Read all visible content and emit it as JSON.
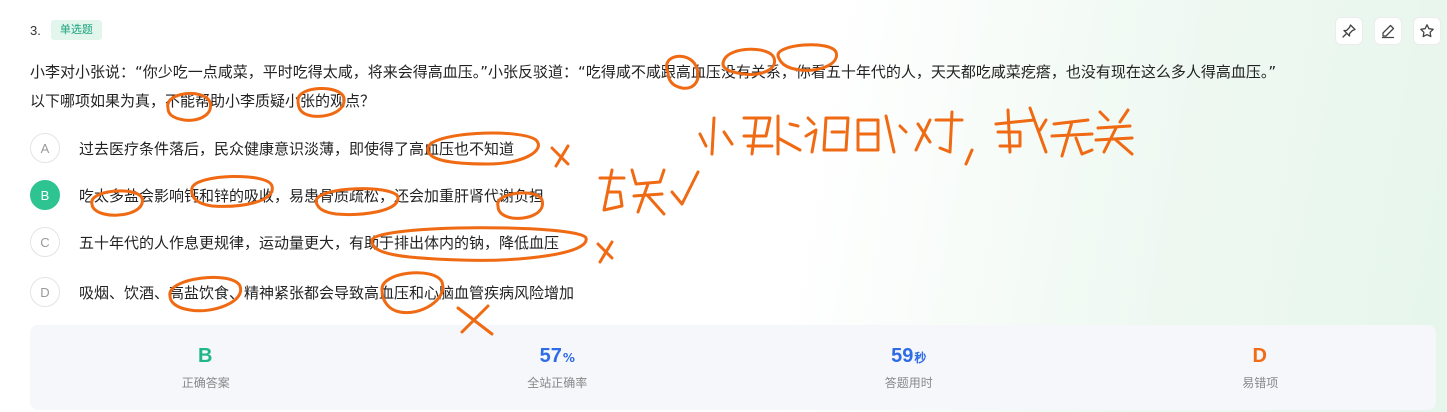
{
  "question": {
    "number": "3.",
    "type_badge": "单选题",
    "stem_line1": "小李对小张说：“你少吃一点咸菜，平时吃得太咸，将来会得高血压。”小张反驳道：“吃得咸不咸跟高血压没有关系，你看五十年代的人，天天都吃咸菜疙瘩，也没有现在这么多人得高血压。”",
    "stem_line2": "以下哪项如果为真，不能帮助小李质疑小张的观点？"
  },
  "toolbar": {
    "pin_icon": "pin-icon",
    "edit_icon": "edit-icon",
    "star_icon": "star-icon"
  },
  "options": [
    {
      "letter": "A",
      "text": "过去医疗条件落后，民众健康意识淡薄，即使得了高血压也不知道",
      "selected": false
    },
    {
      "letter": "B",
      "text": "吃太多盐会影响钙和锌的吸收，易患骨质疏松，还会加重肝肾代谢负担",
      "selected": true
    },
    {
      "letter": "C",
      "text": "五十年代的人作息更规律，运动量更大，有助于排出体内的钠，降低血压",
      "selected": false
    },
    {
      "letter": "D",
      "text": "吸烟、饮酒、高盐饮食、精神紧张都会导致高血压和心脑血管疾病风险增加",
      "selected": false
    }
  ],
  "stats": [
    {
      "value": "B",
      "unit": "",
      "label": "正确答案",
      "color": "#1fb786"
    },
    {
      "value": "57",
      "unit": "%",
      "label": "全站正确率",
      "color": "#2e6be6"
    },
    {
      "value": "59",
      "unit": "秒",
      "label": "答题用时",
      "color": "#2e6be6"
    },
    {
      "value": "D",
      "unit": "",
      "label": "易错项",
      "color": "#f26b16"
    }
  ],
  "colors": {
    "accent_green": "#2ec492",
    "ink_orange": "#ef6a13"
  }
}
